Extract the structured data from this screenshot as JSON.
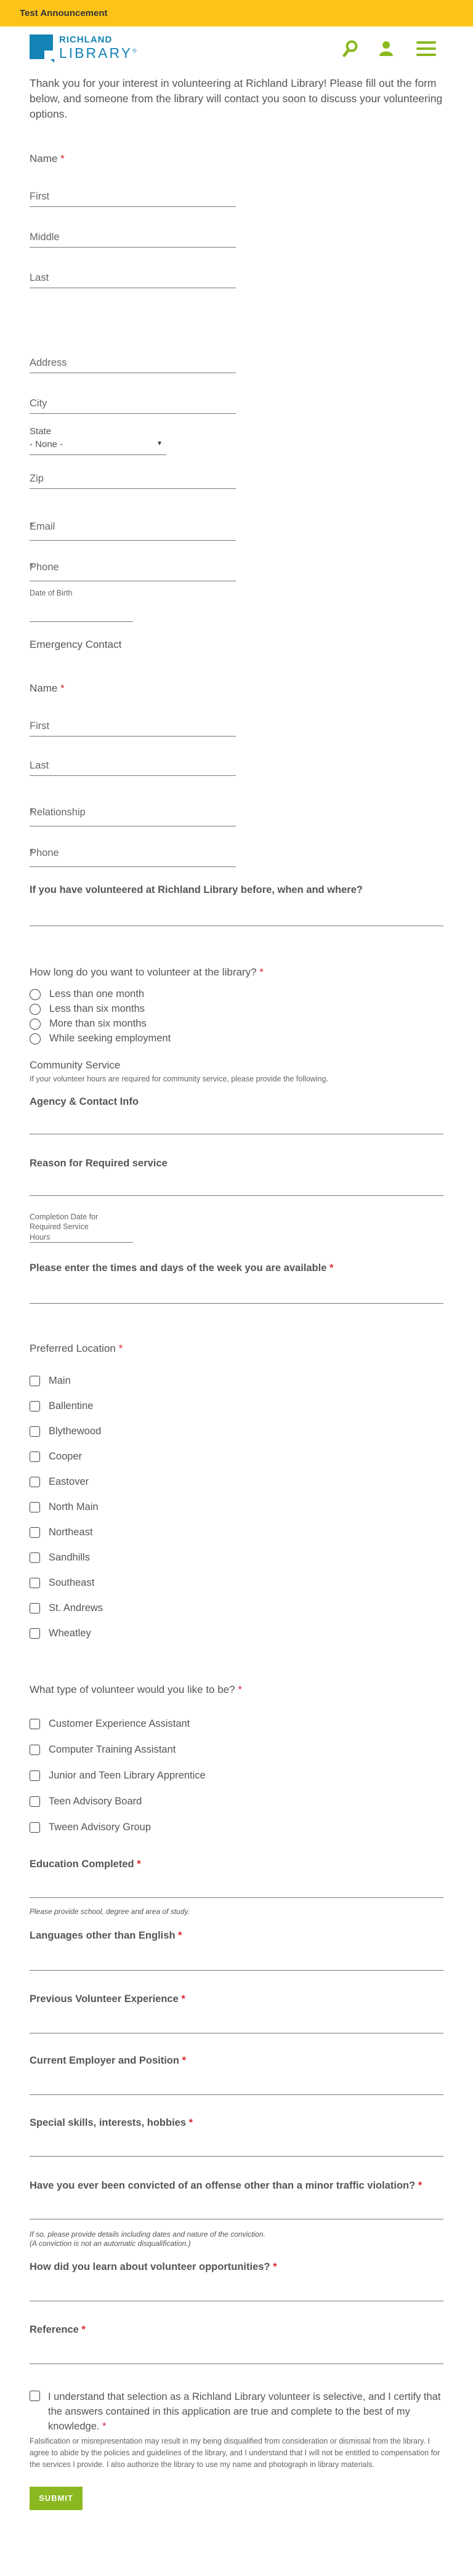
{
  "announcement": "Test Announcement",
  "brand": {
    "line1": "RICHLAND",
    "line2": "LIBRARY",
    "mark": "®"
  },
  "icons": {
    "search": "search-icon",
    "account": "person-icon",
    "menu": "hamburger-menu-icon"
  },
  "colors": {
    "announcement_bg": "#fcc419",
    "brand_blue": "#1483b5",
    "accent_green": "#8bb820",
    "required_red": "#d9262e"
  },
  "intro": "Thank you for your interest in volunteering at Richland Library! Please fill out the form below, and someone from the library will contact you soon to discuss your volunteering options.",
  "name_section": {
    "label": "Name",
    "first": "First",
    "middle": "Middle",
    "last": "Last"
  },
  "address": {
    "address": "Address",
    "city": "City",
    "state_label": "State",
    "state_value": "- None -",
    "zip": "Zip"
  },
  "contact": {
    "email": "Email",
    "phone": "Phone",
    "dob": "Date of Birth"
  },
  "emergency": {
    "heading": "Emergency Contact",
    "name": "Name",
    "first": "First",
    "last": "Last",
    "relationship": "Relationship",
    "phone": "Phone"
  },
  "previously_volunteered": "If you have volunteered at Richland Library before, when and where?",
  "duration": {
    "question": "How long do you want to volunteer at the library?",
    "options": [
      "Less than one month",
      "Less than six months",
      "More than six months",
      "While seeking employment"
    ]
  },
  "community": {
    "heading": "Community Service",
    "help": "If your volunteer hours are required for community service, please provide the following.",
    "agency": "Agency & Contact Info",
    "reason": "Reason for Required service",
    "completion_date": "Completion Date for Required Service",
    "hours": "Hours"
  },
  "availability": "Please enter the times and days of the week you are available",
  "locations": {
    "label": "Preferred Location",
    "options": [
      "Main",
      "Ballentine",
      "Blythewood",
      "Cooper",
      "Eastover",
      "North Main",
      "Northeast",
      "Sandhills",
      "Southeast",
      "St. Andrews",
      "Wheatley"
    ]
  },
  "volunteer_type": {
    "label": "What type of volunteer would you like to be?",
    "options": [
      "Customer Experience Assistant",
      "Computer Training Assistant",
      "Junior and Teen Library Apprentice",
      "Teen Advisory Board",
      "Tween Advisory Group"
    ]
  },
  "education": {
    "label": "Education Completed",
    "note": "Please provide school, degree and area of study."
  },
  "languages": "Languages other than English",
  "prev_experience": "Previous Volunteer Experience",
  "employer": "Current Employer and Position",
  "skills": "Special skills, interests, hobbies",
  "conviction": {
    "label": "Have you ever been convicted of an offense other than a minor traffic violation?",
    "note1": "If so, please provide details including dates and nature of the conviction.",
    "note2": "(A conviction is not an automatic disqualification.)"
  },
  "heard_about": "How did you learn about volunteer opportunities?",
  "reference": "Reference",
  "certify": {
    "text": "I understand that selection as a Richland Library volunteer is selective, and I certify that the answers contained in this application are true and complete to the best of my knowledge.",
    "fine_print": "Falsification or misrepresentation may result in my being disqualified from consideration or dismissal from the library. I agree to abide by the policies and guidelines of the library, and I understand that I will not be entitled to compensation for the services I provide. I also authorize the library to use my name and photograph in library materials."
  },
  "submit": "SUBMIT",
  "required_mark": "*"
}
